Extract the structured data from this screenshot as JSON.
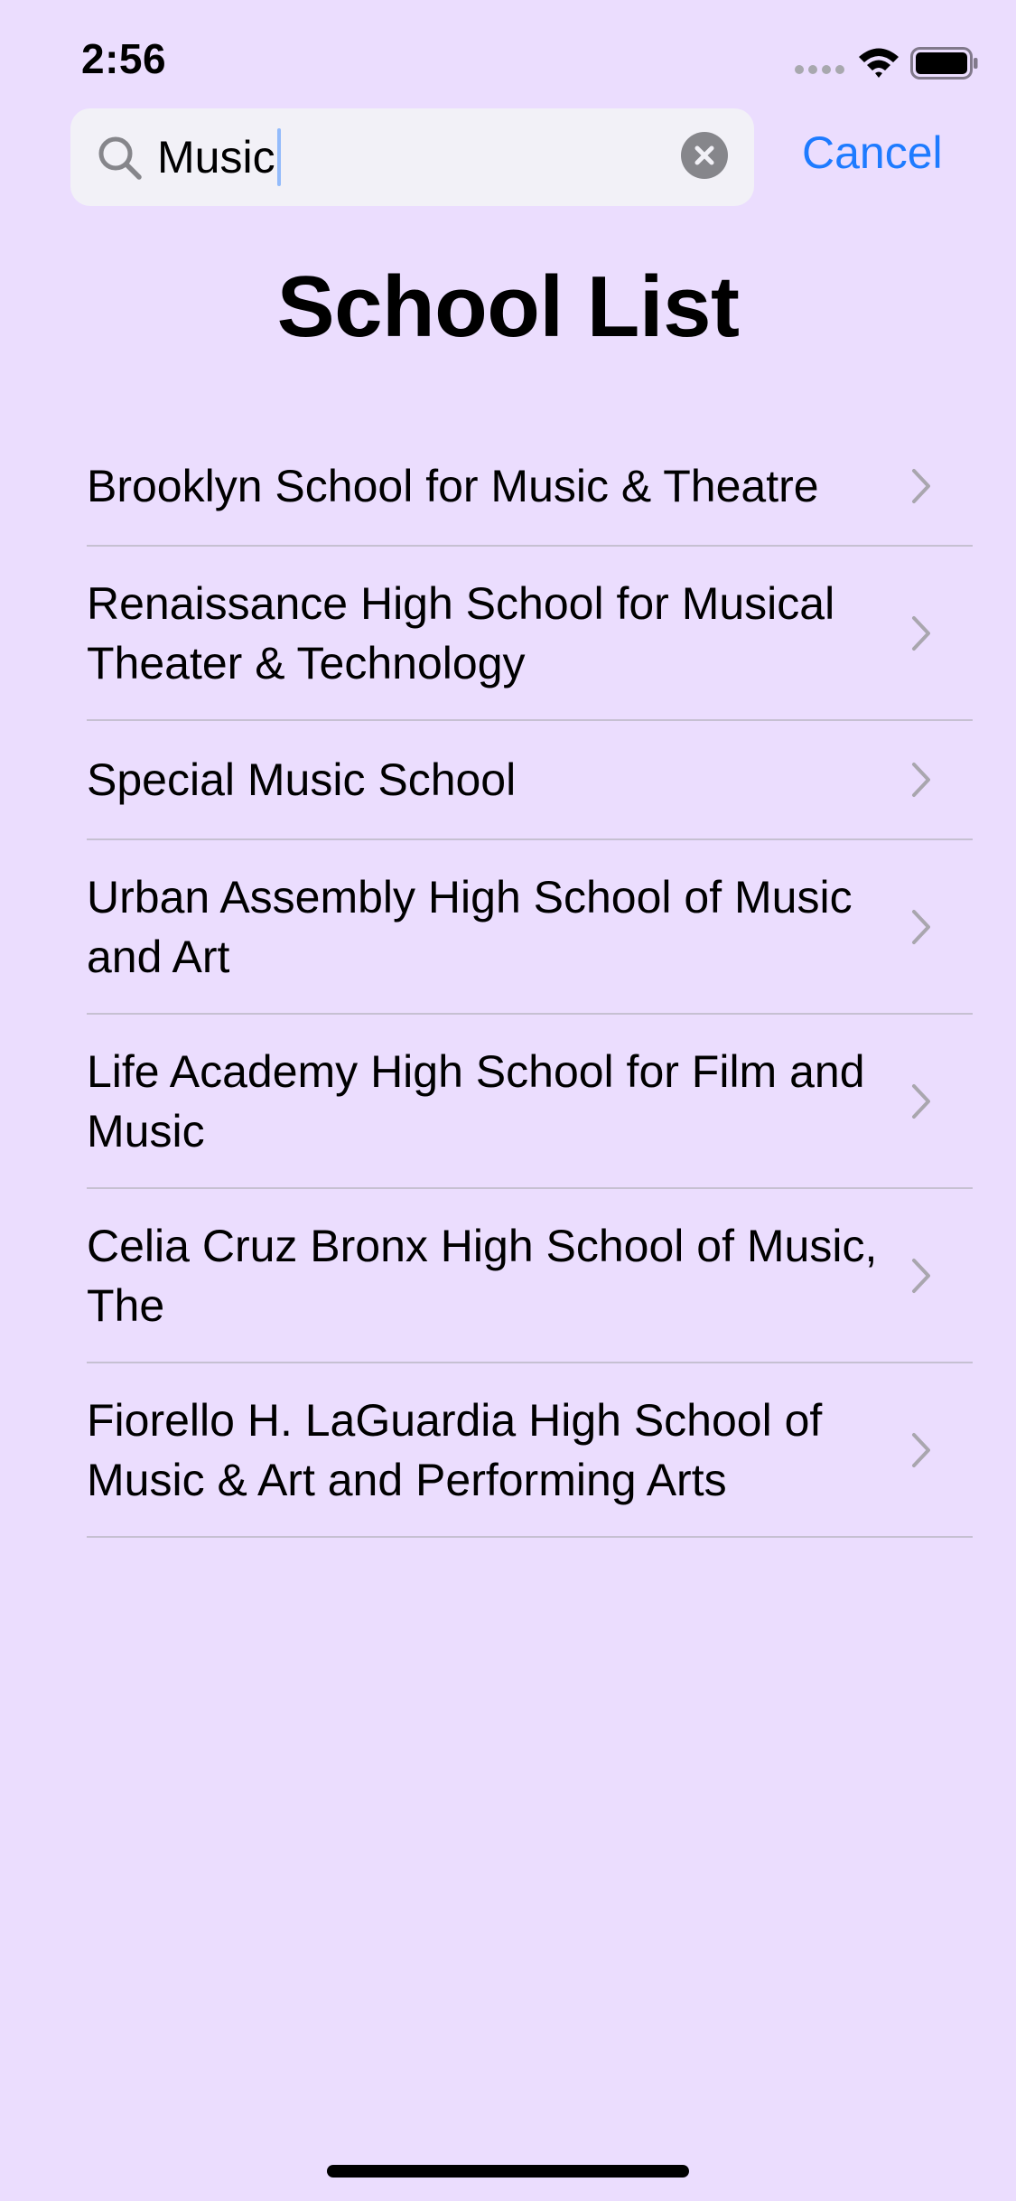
{
  "status_bar": {
    "time": "2:56",
    "icons": [
      "cellular-signal-icon",
      "wifi-icon",
      "battery-icon"
    ]
  },
  "search": {
    "value": "Music",
    "icons": [
      "search-icon",
      "clear-icon"
    ],
    "cancel_label": "Cancel"
  },
  "title": "School List",
  "list": {
    "items": [
      {
        "label": "Brooklyn School for Music & Theatre"
      },
      {
        "label": "Renaissance High School for Musical Theater & Technology"
      },
      {
        "label": "Special Music School"
      },
      {
        "label": "Urban Assembly High School of Music and Art"
      },
      {
        "label": "Life Academy High School for Film and Music"
      },
      {
        "label": "Celia Cruz Bronx High School of Music, The"
      },
      {
        "label": "Fiorello H. LaGuardia High School of Music & Art and Performing Arts"
      }
    ],
    "row_icon": "chevron-right-icon"
  },
  "colors": {
    "background": "#EBDDFE",
    "accent": "#1E7BFF",
    "search_field": "#F2F1F7",
    "separator": "#C6C0D2",
    "chevron": "#A9A6AE"
  }
}
